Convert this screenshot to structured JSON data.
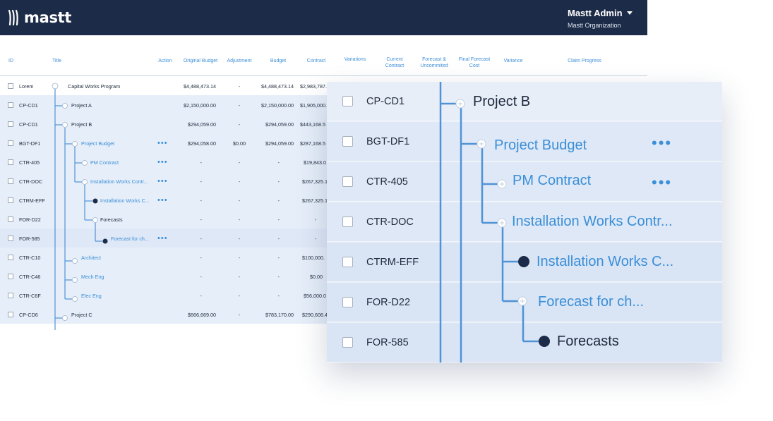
{
  "brand": {
    "name": "mastt"
  },
  "user": {
    "name": "Mastt Admin",
    "org": "Mastt Organization"
  },
  "headers": {
    "id": "ID",
    "title": "Title",
    "action": "Action",
    "original_budget": "Original Budget",
    "adjustment": "Adjustment",
    "budget": "Budget",
    "contract": "Contract",
    "variations": "Variations",
    "current_contract": "Current Contract",
    "forecast_uncommitted": "Forecast & Uncommited",
    "final_forecast_cost": "Final Forecast Cost",
    "variance": "Variance",
    "claim_progress": "Claim Progress"
  },
  "rows": [
    {
      "id": "Lorem",
      "title": "Capital Works Program",
      "orig": "$4,488,473.14",
      "adj": "-",
      "budget": "$4,488,473.14",
      "contract": "$2,983,787."
    },
    {
      "id": "CP-CD1",
      "title": "Project A",
      "orig": "$2,150,000.00",
      "adj": "-",
      "budget": "$2,150,000.00",
      "contract": "$1,905,000."
    },
    {
      "id": "CP-CD1",
      "title": "Project B",
      "orig": "$294,059.00",
      "adj": "-",
      "budget": "$294,059.00",
      "contract": "$443,168.5"
    },
    {
      "id": "BGT-DF1",
      "title": "Project Budget",
      "orig": "$294,058.00",
      "adj": "$0.00",
      "budget": "$294,059.00",
      "contract": "$287,168.5"
    },
    {
      "id": "CTR-405",
      "title": "PM Contract",
      "orig": "-",
      "adj": "-",
      "budget": "-",
      "contract": "$19,843.0"
    },
    {
      "id": "CTR-DOC",
      "title": "Installation Works Contr...",
      "orig": "-",
      "adj": "-",
      "budget": "-",
      "contract": "$267,325.1"
    },
    {
      "id": "CTRM-EFF",
      "title": "Installation Works C...",
      "orig": "-",
      "adj": "-",
      "budget": "-",
      "contract": "$267,325.1"
    },
    {
      "id": "FOR-D22",
      "title": "Forecasts",
      "orig": "-",
      "adj": "-",
      "budget": "-",
      "contract": "-"
    },
    {
      "id": "FOR-585",
      "title": "Forecast for ch...",
      "orig": "-",
      "adj": "-",
      "budget": "-",
      "contract": "-"
    },
    {
      "id": "CTR-C10",
      "title": "Architect",
      "orig": "-",
      "adj": "-",
      "budget": "-",
      "contract": "$100,000."
    },
    {
      "id": "CTR-C46",
      "title": "Mech Eng",
      "orig": "-",
      "adj": "-",
      "budget": "-",
      "contract": "$0.00"
    },
    {
      "id": "CTR-C6F",
      "title": "Elec Eng",
      "orig": "-",
      "adj": "-",
      "budget": "-",
      "contract": "$56,000.0"
    },
    {
      "id": "CP-CD6",
      "title": "Project C",
      "orig": "$666,669.00",
      "adj": "-",
      "budget": "$783,170.00",
      "contract": "$290,606.4"
    }
  ],
  "zoom": {
    "rows": [
      {
        "id": "CP-CD1",
        "title": "Project B"
      },
      {
        "id": "BGT-DF1",
        "title": "Project Budget"
      },
      {
        "id": "CTR-405",
        "title": "PM Contract"
      },
      {
        "id": "CTR-DOC",
        "title": "Installation Works Contr..."
      },
      {
        "id": "CTRM-EFF",
        "title": "Installation Works C..."
      },
      {
        "id": "FOR-D22",
        "title": "Forecast for ch..."
      },
      {
        "id": "FOR-585",
        "title": "Forecasts"
      }
    ]
  },
  "icons": {
    "more": "more-dots-icon",
    "expand": "tree-expand-icon",
    "leaf": "tree-leaf-dot-icon",
    "caret": "caret-down-icon"
  },
  "colors": {
    "header_bg": "#1c2b47",
    "link": "#3a8fd8",
    "tree_line": "#4f93d6",
    "row_highlight": "#e6eef9"
  }
}
